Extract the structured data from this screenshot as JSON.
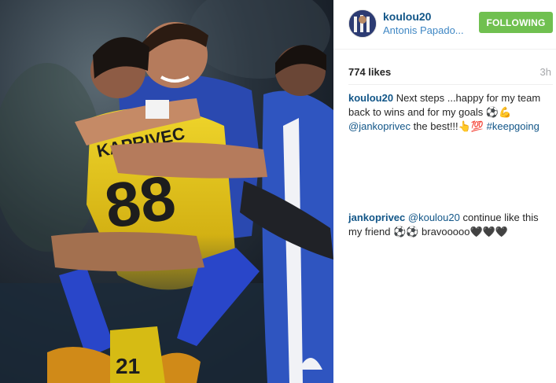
{
  "post": {
    "likes": "774 likes",
    "time": "3h"
  },
  "header": {
    "username": "koulou20",
    "full_name": "Antonis Papado...",
    "follow_label": "FOLLOWING"
  },
  "photo": {
    "jersey_name": "KAPRIVEC",
    "jersey_number": "88",
    "sock_number": "21"
  },
  "comments": [
    {
      "user": "koulou20",
      "text_1": " Next steps ...happy for my team back to wins and for my goals ⚽💪 ",
      "mention": "@jankoprivec",
      "text_2": " the best!!!👆💯 ",
      "hashtag": "#keepgoing"
    },
    {
      "user": "jankoprivec",
      "text_1": " ",
      "mention": "@koulou20",
      "text_2": " continue like this my friend ⚽⚽ bravooooo🖤🖤🖤"
    }
  ],
  "colors": {
    "follow_button": "#70c050",
    "username": "#125688",
    "jersey_yellow": "#e6c71c",
    "kit_blue": "#2a49b0"
  }
}
